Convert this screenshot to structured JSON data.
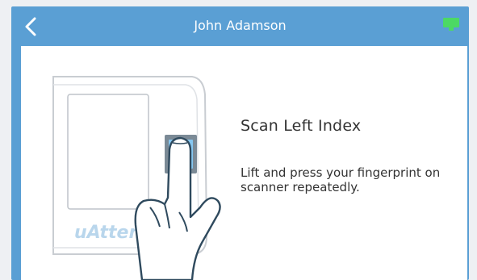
{
  "header": {
    "title": "John Adamson",
    "back_icon": "chevron-left-icon",
    "status_icon": "battery-icon",
    "accent_color": "#5a9fd4"
  },
  "scanner": {
    "brand_text": "uAtten",
    "prompt_title": "Scan Left Index",
    "instruction": "Lift and press your fingerprint on scanner repeatedly."
  }
}
